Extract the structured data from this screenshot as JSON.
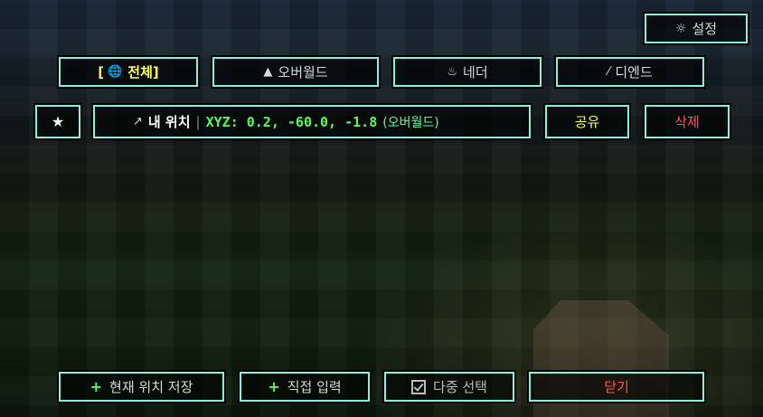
{
  "header": {
    "settings": {
      "icon": "gear-icon",
      "glyph": "☼",
      "label": "설정"
    }
  },
  "tabs": [
    {
      "id": "all",
      "icon": "globe-icon",
      "glyph": "🌐",
      "label": "전체",
      "bracket_open": "[",
      "bracket_close": "]",
      "active": true
    },
    {
      "id": "overworld",
      "icon": "tree-icon",
      "glyph": "▲",
      "label": "오버월드",
      "active": false
    },
    {
      "id": "nether",
      "icon": "fire-icon",
      "glyph": "♨",
      "label": "네더",
      "active": false
    },
    {
      "id": "end",
      "icon": "wand-icon",
      "glyph": "⁄",
      "label": "디엔드",
      "active": false
    }
  ],
  "location": {
    "favorite_glyph": "★",
    "pin_glyph": "↗",
    "name": "내 위치",
    "separator": "|",
    "coords": "XYZ: 0.2, -60.0, -1.8",
    "dimension": "(오버월드)",
    "share_label": "공유",
    "delete_label": "삭제"
  },
  "footer": {
    "save_current": {
      "plus": "+",
      "label": "현재 위치 저장"
    },
    "manual_input": {
      "plus": "+",
      "label": "직접 입력"
    },
    "multi_select": {
      "label": "다중 선택",
      "checked": true
    },
    "close": {
      "label": "닫기"
    }
  },
  "colors": {
    "border": "#7ff5e0",
    "active": "#ffff55",
    "coords": "#55ff55",
    "delete": "#ff5555"
  }
}
